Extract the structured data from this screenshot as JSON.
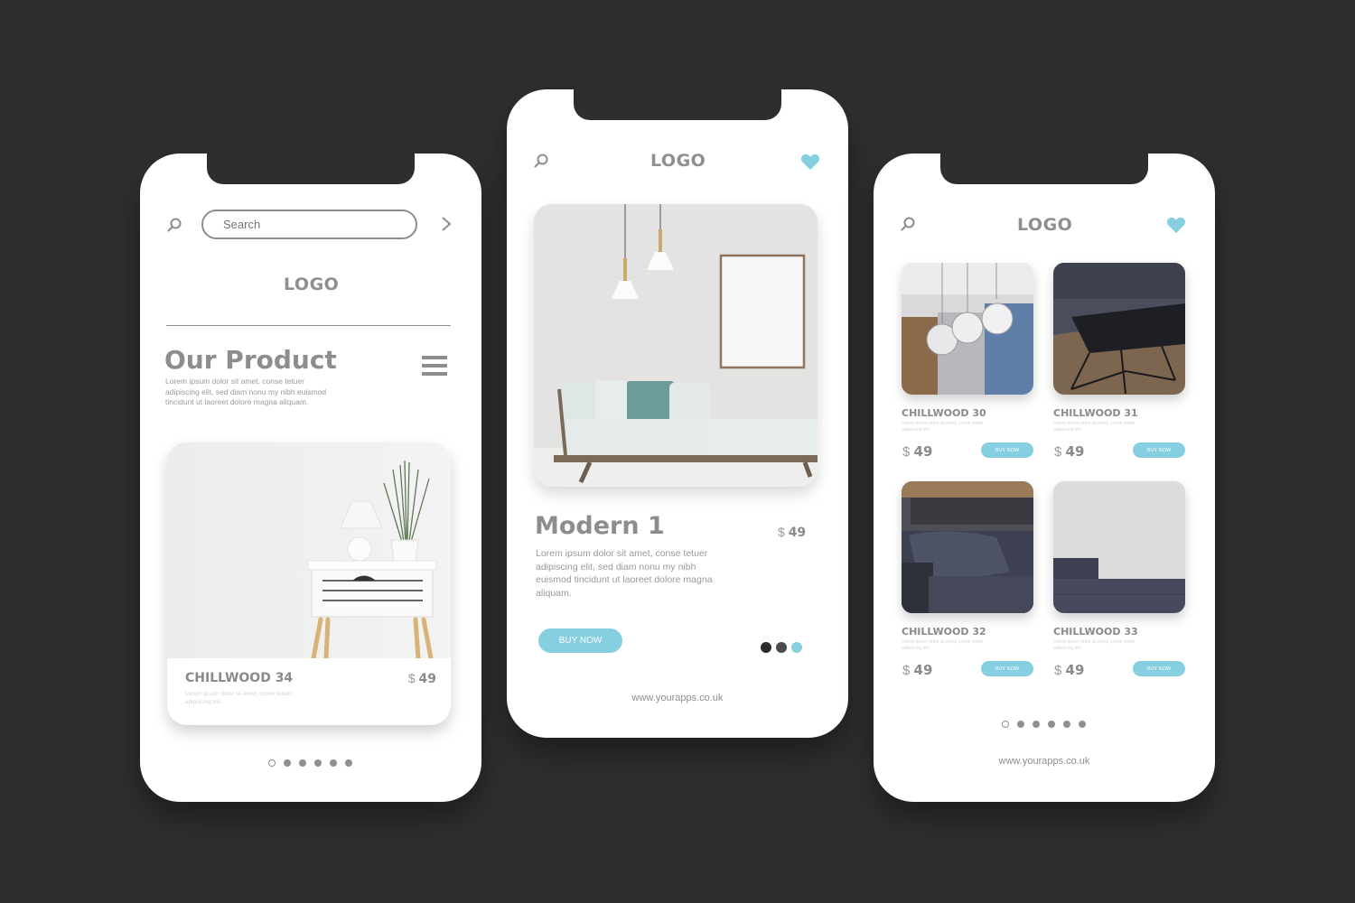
{
  "colors": {
    "background": "#2e2e2e",
    "accent": "#85cfe0",
    "text_gray": "#8a8a8a"
  },
  "left_phone": {
    "search_placeholder": "Search",
    "logo": "LOGO",
    "title": "Our Product",
    "description": "Lorem ipsum dolor sit amet, conse tetuer adipiscing elit, sed diam nonu my nibh euismod tincidunt ut laoreet dolore magna aliquam.",
    "product": {
      "name": "CHILLWOOD 34",
      "description": "Lorem ipsum dolor sit amet, conse tetuer adipiscing elit.",
      "currency": "$",
      "price": "49"
    },
    "pagination": {
      "total": 6,
      "active_index": 0
    }
  },
  "middle_phone": {
    "logo": "LOGO",
    "product": {
      "name": "Modern 1",
      "currency": "$",
      "price": "49",
      "description": "Lorem ipsum dolor sit amet, conse tetuer adipiscing elit, sed diam nonu my nibh euismod tincidunt ut laoreet dolore magna aliquam.",
      "buy_label": "BUY NOW"
    },
    "carousel_dots": [
      "#2c2c2c",
      "#4a4a4a",
      "#85cfe0"
    ],
    "url": "www.yourapps.co.uk"
  },
  "right_phone": {
    "logo": "LOGO",
    "products": [
      {
        "name": "CHILLWOOD 30",
        "description": "Lorem ipsum dolor sit amet, conse tetuer adipiscing elit.",
        "currency": "$",
        "price": "49",
        "buy_label": "BUY NOW"
      },
      {
        "name": "CHILLWOOD 31",
        "description": "Lorem ipsum dolor sit amet, conse tetuer adipiscing elit.",
        "currency": "$",
        "price": "49",
        "buy_label": "BUY NOW"
      },
      {
        "name": "CHILLWOOD 32",
        "description": "Lorem ipsum dolor sit amet, conse tetuer adipiscing elit.",
        "currency": "$",
        "price": "49",
        "buy_label": "BUY NOW"
      },
      {
        "name": "CHILLWOOD 33",
        "description": "Lorem ipsum dolor sit amet, conse tetuer adipiscing elit.",
        "currency": "$",
        "price": "49",
        "buy_label": "BUY NOW"
      }
    ],
    "pagination": {
      "total": 6,
      "active_index": 0
    },
    "url": "www.yourapps.co.uk"
  }
}
